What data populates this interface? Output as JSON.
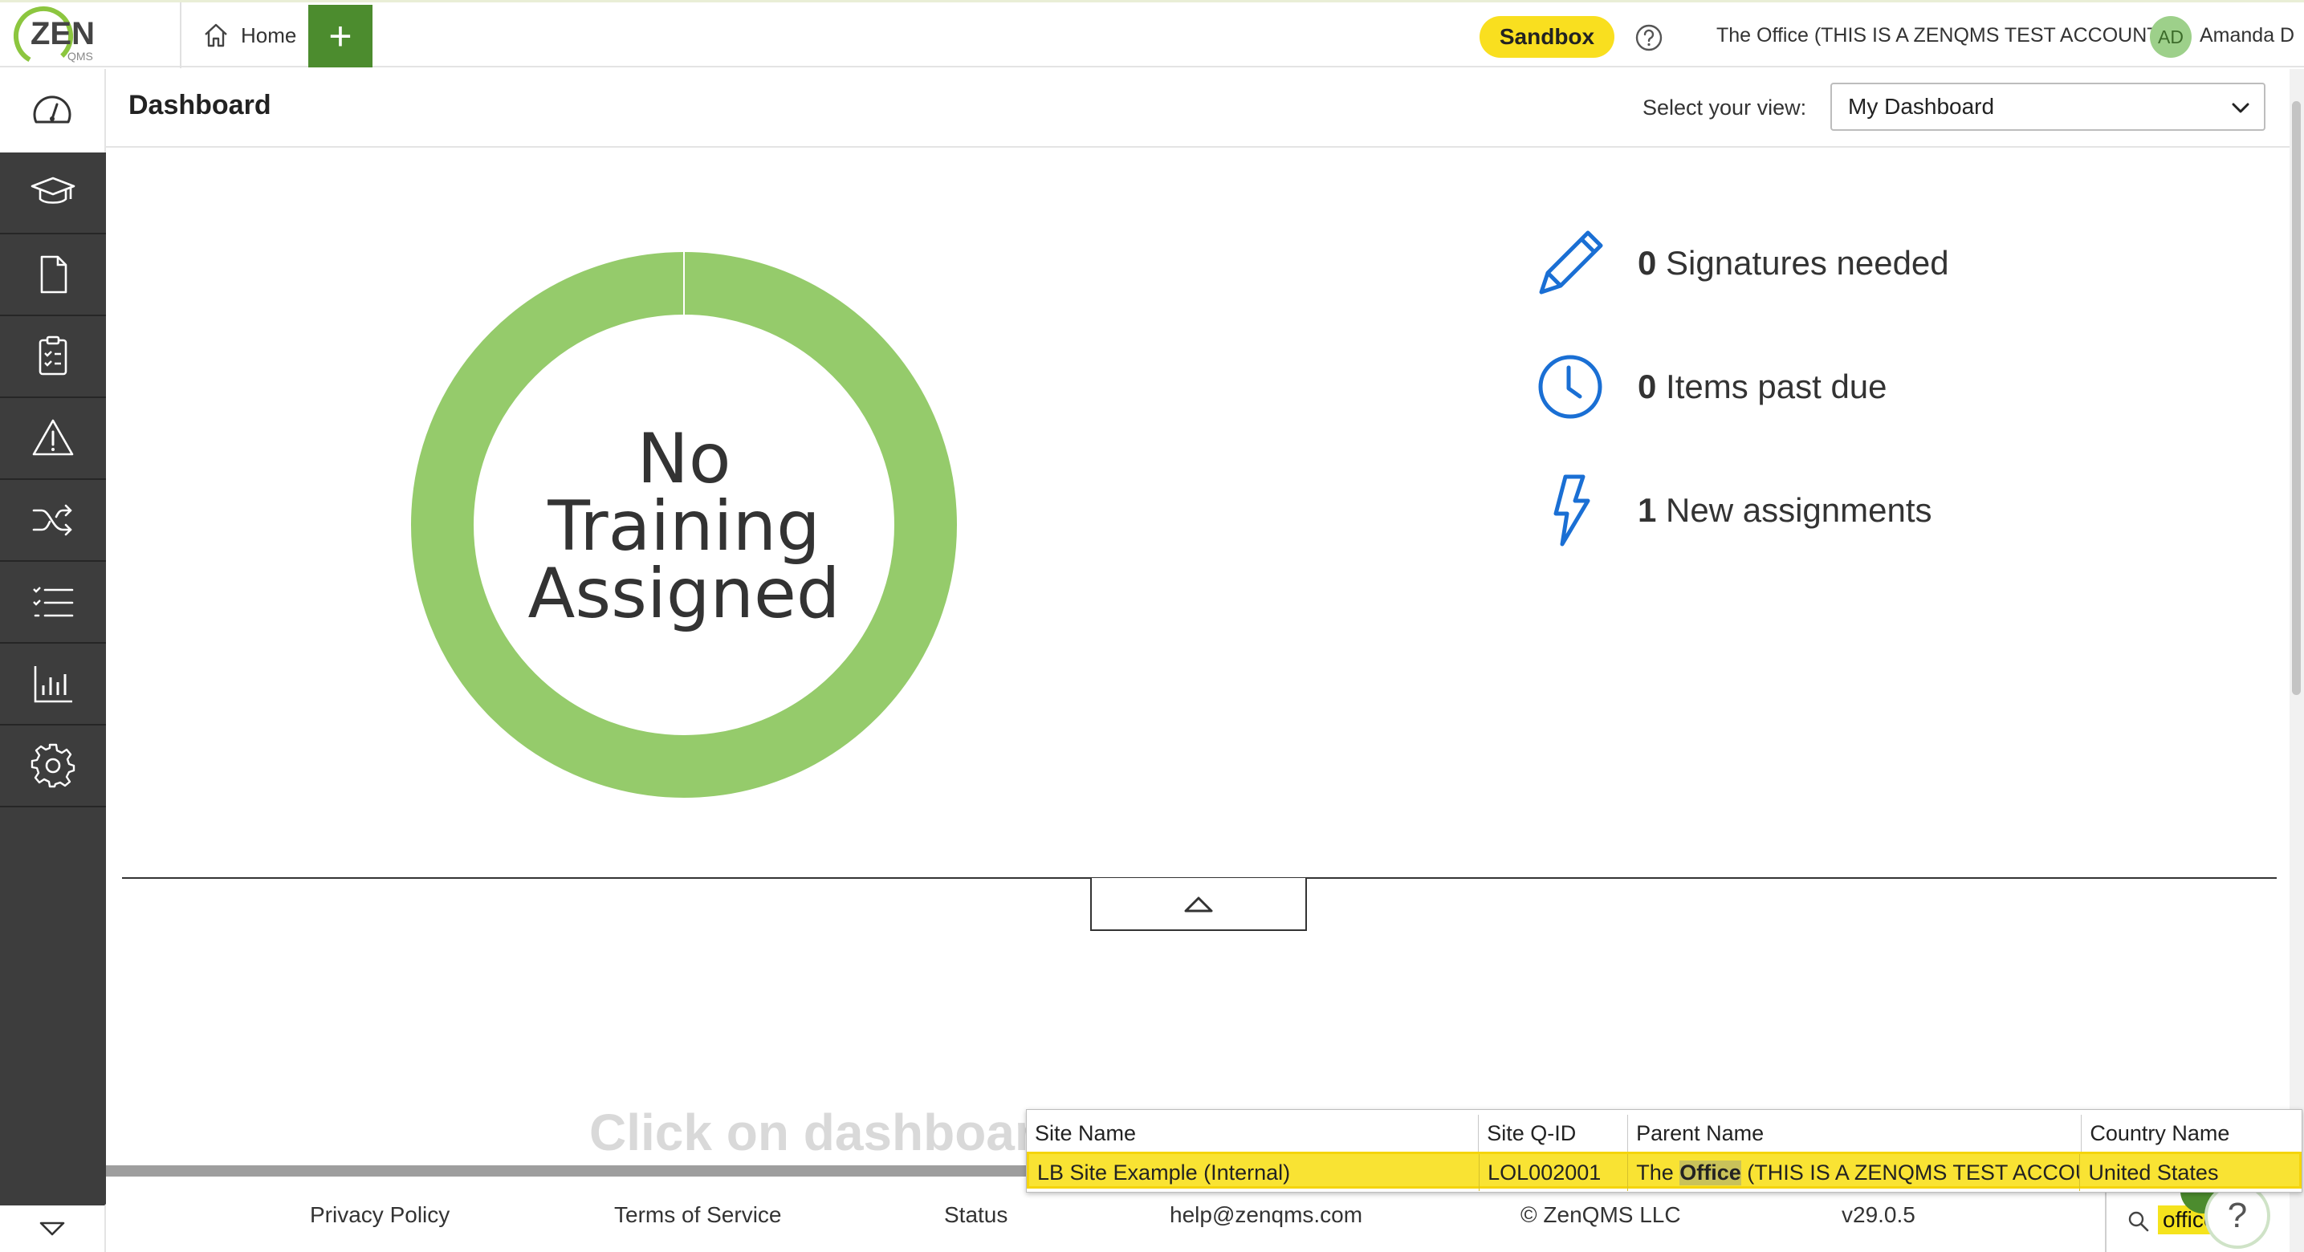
{
  "app": {
    "logo_text": "ZEN",
    "logo_subtext": "QMS",
    "home_tab": "Home",
    "plus_label": "+",
    "sandbox_label": "Sandbox",
    "account": "The Office (THIS IS A ZENQMS TEST ACCOUNT)",
    "user_initials": "AD",
    "user_name": "Amanda D"
  },
  "page": {
    "title": "Dashboard",
    "view_label": "Select your view:",
    "view_value": "My Dashboard"
  },
  "sidebar": {
    "items": [
      "dashboard-icon",
      "training-icon",
      "document-icon",
      "clipboard-checklist-icon",
      "warning-icon",
      "shuffle-icon",
      "checklist-icon",
      "bar-chart-icon",
      "gear-icon"
    ]
  },
  "training": {
    "donut_line1": "No",
    "donut_line2": "Training",
    "donut_line3": "Assigned",
    "color": "#95cb6b"
  },
  "stats": [
    {
      "icon": "pencil-icon",
      "count": "0",
      "label": "Signatures needed"
    },
    {
      "icon": "clock-icon",
      "count": "0",
      "label": "Items past due"
    },
    {
      "icon": "lightning-icon",
      "count": "1",
      "label": "New assignments"
    }
  ],
  "watermark": "Click on dashboard",
  "footer": {
    "privacy": "Privacy Policy",
    "terms": "Terms of Service",
    "status": "Status",
    "email": "help@zenqms.com",
    "copyright": "© ZenQMS LLC",
    "version": "v29.0.5",
    "search_query": "office",
    "help_fab": "?"
  },
  "search_results": {
    "headers": [
      "Site Name",
      "Site Q-ID",
      "Parent Name",
      "Country Name"
    ],
    "rows": [
      {
        "site_name": "LB Site Example (Internal)",
        "site_qid": "LOL002001",
        "parent_prefix": "The ",
        "parent_match": "Office",
        "parent_suffix": " (THIS IS A ZENQMS TEST ACCOU",
        "country": "United States"
      }
    ]
  },
  "colors": {
    "brand_green": "#4c8c2e",
    "sandbox_yellow": "#f9df1f",
    "sidebar_dark": "#3d3d3d",
    "icon_blue": "#1a6fd4",
    "highlight_yellow": "#f9e333"
  }
}
